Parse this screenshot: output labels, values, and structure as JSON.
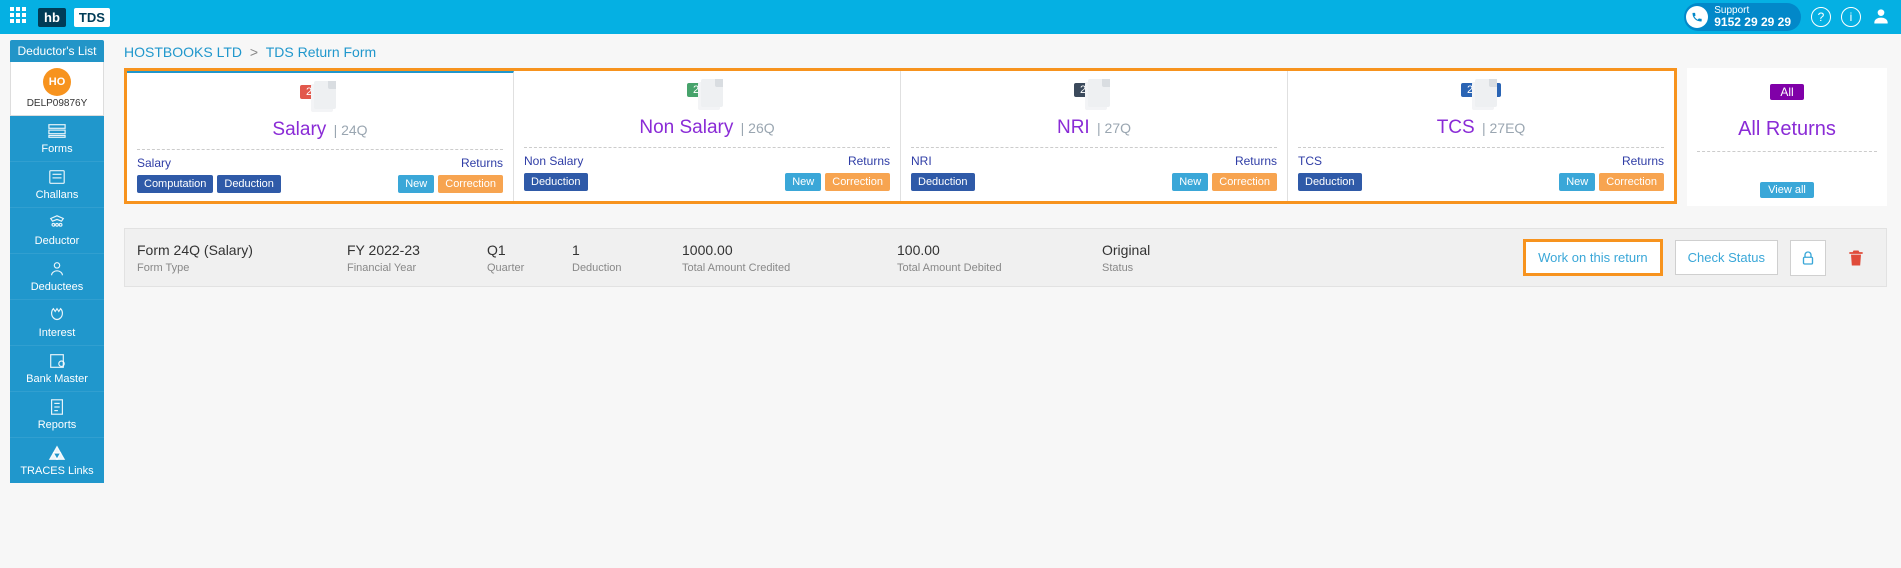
{
  "top": {
    "logo_hb": "hb",
    "logo_tds": "TDS",
    "support_label": "Support",
    "support_phone": "9152 29 29 29",
    "help_glyph": "?",
    "info_glyph": "i"
  },
  "sidebar": {
    "title": "Deductor's List",
    "avatar_initials": "HO",
    "avatar_code": "DELP09876Y",
    "items": [
      {
        "label": "Forms"
      },
      {
        "label": "Challans"
      },
      {
        "label": "Deductor"
      },
      {
        "label": "Deductees"
      },
      {
        "label": "Interest"
      },
      {
        "label": "Bank Master"
      },
      {
        "label": "Reports"
      },
      {
        "label": "TRACES Links"
      }
    ]
  },
  "breadcrumb": {
    "org": "HOSTBOOKS LTD",
    "page": "TDS Return Form"
  },
  "cards": [
    {
      "badge": "24Q",
      "badge_color": "#e2584c",
      "title": "Salary",
      "code": "| 24Q",
      "label": "Salary",
      "link": "Returns",
      "left_btns": [
        "Computation",
        "Deduction"
      ],
      "right_btns": [
        "New",
        "Correction"
      ]
    },
    {
      "badge": "26Q",
      "badge_color": "#47a36b",
      "title": "Non Salary",
      "code": "| 26Q",
      "label": "Non Salary",
      "link": "Returns",
      "left_btns": [
        "Deduction"
      ],
      "right_btns": [
        "New",
        "Correction"
      ]
    },
    {
      "badge": "27Q",
      "badge_color": "#3b4a5c",
      "title": "NRI",
      "code": "| 27Q",
      "label": "NRI",
      "link": "Returns",
      "left_btns": [
        "Deduction"
      ],
      "right_btns": [
        "New",
        "Correction"
      ]
    },
    {
      "badge": "27EQ",
      "badge_color": "#2a64b4",
      "title": "TCS",
      "code": "| 27EQ",
      "label": "TCS",
      "link": "Returns",
      "left_btns": [
        "Deduction"
      ],
      "right_btns": [
        "New",
        "Correction"
      ]
    }
  ],
  "all_card": {
    "badge": "All",
    "title": "All Returns",
    "viewall": "View all"
  },
  "summary": {
    "form_type": "Form 24Q (Salary)",
    "form_type_lbl": "Form Type",
    "fy": "FY 2022-23",
    "fy_lbl": "Financial Year",
    "quarter": "Q1",
    "quarter_lbl": "Quarter",
    "ded_count": "1",
    "ded_count_lbl": "Deduction",
    "credited": "1000.00",
    "credited_lbl": "Total Amount Credited",
    "debited": "100.00",
    "debited_lbl": "Total Amount Debited",
    "status": "Original",
    "status_lbl": "Status",
    "work_btn": "Work on this return",
    "check_btn": "Check Status"
  }
}
